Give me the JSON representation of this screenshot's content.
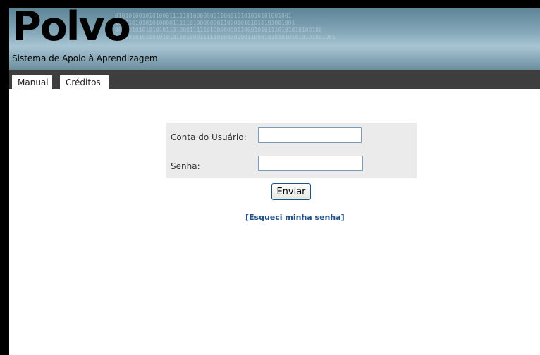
{
  "header": {
    "logo_text": "Polvo",
    "tagline": "Sistema de Apoio à Aprendizagem",
    "binary_lines": [
      "0101010010101000111110100000001100010101010101001001",
      "10101010101010000111110100000001100010101010101001001",
      "0001010101010101101000111110100000001100010101110101010100100",
      "01010101011010101011010001111101000000011000101010101010101001001"
    ]
  },
  "nav": {
    "items": [
      {
        "label": "Manual"
      },
      {
        "label": "Créditos"
      }
    ]
  },
  "login": {
    "username_label": "Conta do Usuário:",
    "username_value": "",
    "password_label": "Senha:",
    "password_value": "",
    "submit_label": "Enviar",
    "forgot_label": "[Esqueci minha senha]"
  }
}
